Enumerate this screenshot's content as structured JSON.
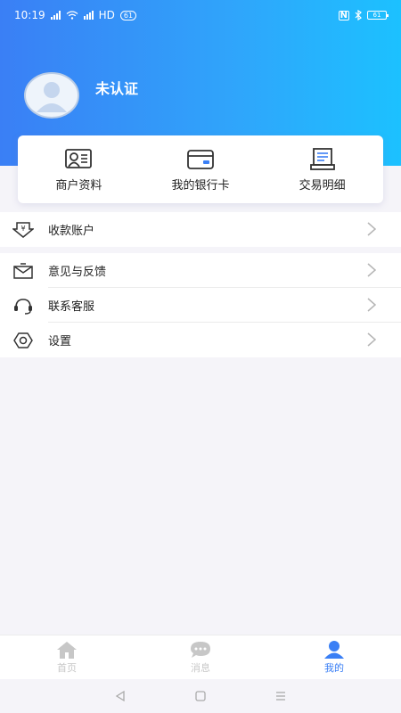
{
  "status_bar": {
    "time": "10:19",
    "signal_badge": "HD",
    "battery": "61"
  },
  "profile": {
    "name": "未认证",
    "avatar_icon": "avatar-placeholder-icon"
  },
  "quick_actions": [
    {
      "label": "商户资料",
      "icon": "merchant-profile-icon"
    },
    {
      "label": "我的银行卡",
      "icon": "bank-card-icon"
    },
    {
      "label": "交易明细",
      "icon": "transaction-details-icon"
    }
  ],
  "menu_top": [
    {
      "label": "收款账户",
      "icon": "receiving-account-icon"
    }
  ],
  "menu_main": [
    {
      "label": "意见与反馈",
      "icon": "feedback-mail-icon"
    },
    {
      "label": "联系客服",
      "icon": "headset-icon"
    },
    {
      "label": "设置",
      "icon": "settings-gear-icon"
    }
  ],
  "tabbar": [
    {
      "label": "首页",
      "icon": "home-icon",
      "active": false
    },
    {
      "label": "消息",
      "icon": "message-icon",
      "active": false
    },
    {
      "label": "我的",
      "icon": "profile-icon",
      "active": true
    }
  ],
  "colors": {
    "accent": "#3a7ff5",
    "header_start": "#3a7ff5",
    "header_end": "#1cc1ff",
    "tab_inactive": "#c7c7c7",
    "background": "#f5f4f9"
  }
}
